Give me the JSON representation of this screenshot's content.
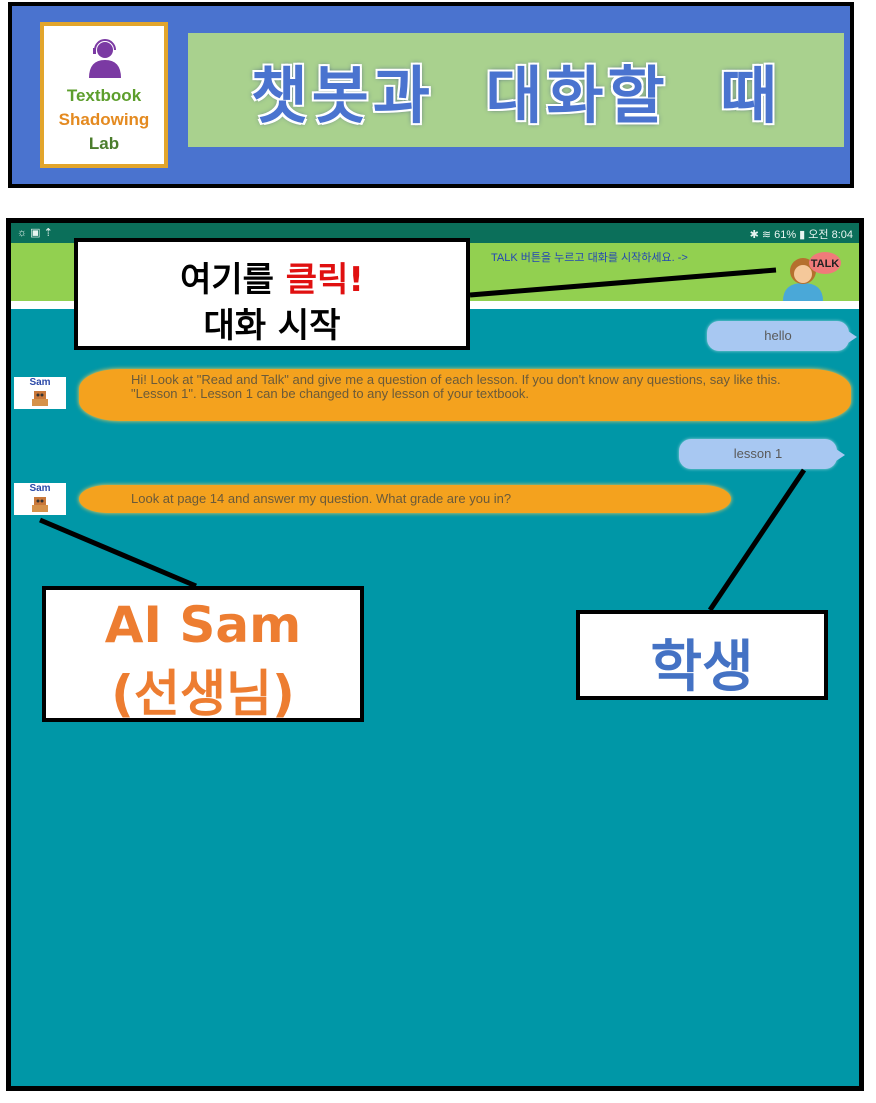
{
  "banner": {
    "logo": {
      "line1": "Textbook",
      "line2": "Shadowing",
      "line3": "Lab"
    },
    "title": "챗봇과 대화할 때"
  },
  "phone": {
    "status": {
      "left": "☼ ▣ ⇡",
      "right": "✱ ≋ 61% ▮ 오전 8:04"
    },
    "hint": "TALK 버튼을 누르고 대화를 시작하세요. ->",
    "talk_button": "TALK",
    "messages": {
      "user1": "hello",
      "bot1": "Hi! Look at \"Read and Talk\" and give me a question of  each lesson. If you don't know any questions, say like this. \"Lesson 1\".  Lesson 1 can be changed to any lesson of your textbook.",
      "user2": "lesson 1",
      "bot2": "Look at page 14 and answer my question. What grade are you in?"
    },
    "bot_avatar_label": "Sam"
  },
  "callouts": {
    "click": {
      "line1_prefix": "여기를 ",
      "line1_red": "클릭!",
      "line2": "대화 시작"
    },
    "sam": {
      "line1": "AI Sam",
      "line2": "(선생님)"
    },
    "student": {
      "text": "학생"
    }
  },
  "colors": {
    "banner_bg": "#4a73cf",
    "title_bg": "#a9d18e",
    "phone_bg": "#0097a7",
    "appbar_bg": "#92d050",
    "bot_bubble": "#f4a21e",
    "user_bubble": "#a8c8f2",
    "callout_red": "#e01010",
    "callout_orange": "#ed7d31",
    "callout_blue": "#4472c4"
  }
}
